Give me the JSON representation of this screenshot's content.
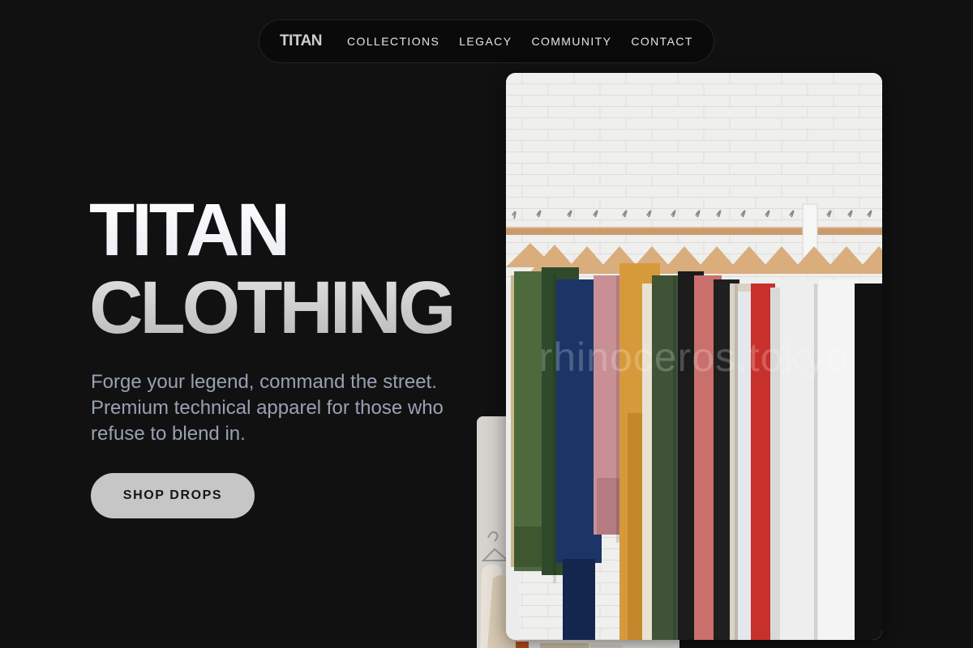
{
  "nav": {
    "logo": "TITAN",
    "links": [
      {
        "label": "COLLECTIONS"
      },
      {
        "label": "LEGACY"
      },
      {
        "label": "COMMUNITY"
      },
      {
        "label": "CONTACT"
      }
    ]
  },
  "hero": {
    "title_line_1": "TITAN",
    "title_line_2": "CLOTHING",
    "subtitle": "Forge your legend, command the street. Premium technical apparel for those who refuse to blend in.",
    "cta_label": "SHOP DROPS"
  },
  "images": {
    "main_watermark": "rhinoceros.tokyo"
  },
  "colors": {
    "background": "#111111",
    "nav_background": "#0a0a0a",
    "cta_background": "#c6c6c6",
    "subtitle": "#98a1b3"
  }
}
